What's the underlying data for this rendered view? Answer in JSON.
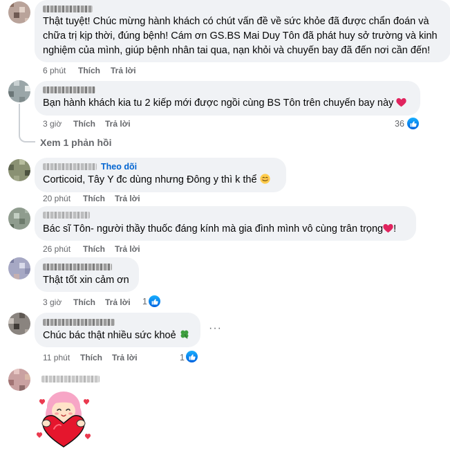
{
  "comments": [
    {
      "text": "Thật tuyệt! Chúc mừng hành khách có chút vấn đề về sức khỏe đã được chẩn đoán và chữa trị kịp thời, đúng bệnh! Cám ơn GS.BS Mai Duy Tôn đã phát huy sở trường và kinh nghiệm của mình, giúp bệnh nhân tai qua, nạn khỏi và chuyến bay đã đến nơi cần đến!",
      "time": "6 phút",
      "like": "Thích",
      "reply": "Trả lời"
    },
    {
      "text": "Bạn hành khách kia tu 2 kiếp mới được ngồi cùng BS Tôn trên chuyến bay này",
      "emoji": "red-heart",
      "time": "3 giờ",
      "like": "Thích",
      "reply": "Trả lời",
      "reaction_count": "36",
      "view_replies": "Xem 1 phản hồi"
    },
    {
      "follow": "Theo dõi",
      "text": "Corticoid, Tây Y đc dùng nhưng Đông y thì k thể",
      "emoji": "smiling-face",
      "time": "20 phút",
      "like": "Thích",
      "reply": "Trả lời"
    },
    {
      "text": "Bác sĩ Tôn- người thầy thuốc đáng kính mà gia đình mình vô cùng trân trọng",
      "emoji": "red-heart",
      "text_tail": "!",
      "time": "26 phút",
      "like": "Thích",
      "reply": "Trả lời"
    },
    {
      "text": "Thật tốt xin cảm ơn",
      "time": "3 giờ",
      "like": "Thích",
      "reply": "Trả lời",
      "reaction_count": "1"
    },
    {
      "text": "Chúc bác thật nhiều sức khoẻ",
      "emoji": "four-leaf-clover",
      "time": "11 phút",
      "like": "Thích",
      "reply": "Trả lời",
      "reaction_count": "1",
      "more": "···"
    },
    {
      "sticker": "girl-hugging-heart-sticker"
    }
  ],
  "colors": {
    "bubble": "#f0f2f5",
    "meta": "#65676b",
    "link": "#0064d1",
    "like_blue": "#0866ff"
  }
}
